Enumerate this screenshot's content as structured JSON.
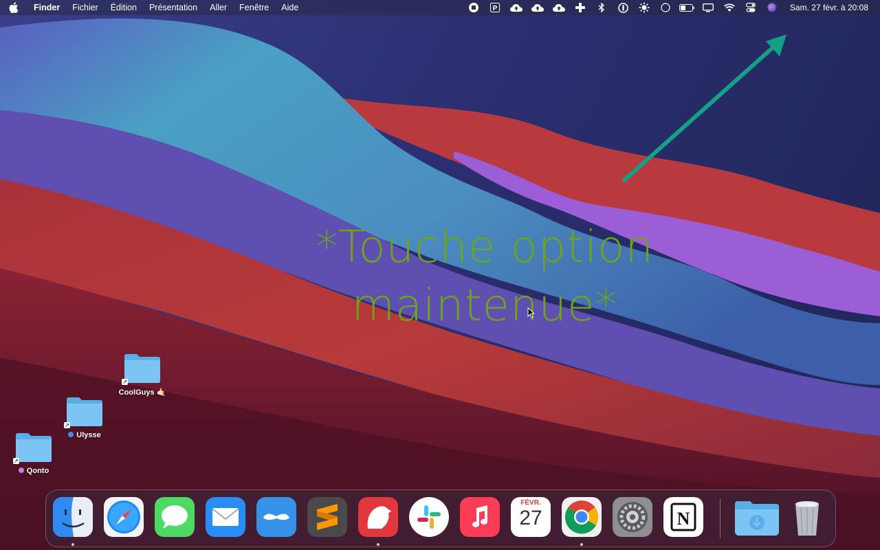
{
  "menubar": {
    "app_name": "Finder",
    "menus": [
      "Fichier",
      "Édition",
      "Présentation",
      "Aller",
      "Fenêtre",
      "Aide"
    ],
    "status_icons": [
      "stop-icon",
      "parking-icon",
      "cloud-upload-icon",
      "cloud-upload-icon",
      "cloud-upload-icon",
      "cross-icon",
      "bluetooth-icon",
      "one-password-icon",
      "sun-icon",
      "circle-icon",
      "battery-icon",
      "display-icon",
      "wifi-icon",
      "control-center-icon",
      "siri-icon"
    ],
    "clock": "Sam. 27 févr. à  20:08"
  },
  "overlay": {
    "line1": "*Touche option",
    "line2": "maintenue*",
    "color": "#6ea41a",
    "arrow_color": "#14a085"
  },
  "desktop_icons": [
    {
      "label": "CoolGuys 🤙🏻",
      "tag_color": null
    },
    {
      "label": "Ulysse",
      "tag_color": "#3b8ef0"
    },
    {
      "label": "Qonto",
      "tag_color": "#c27ee0"
    }
  ],
  "dock": {
    "apps": [
      "Finder",
      "Safari",
      "Messages",
      "Mail",
      "Mastodon",
      "Sublime Text",
      "Bear",
      "Slack",
      "Musique",
      "Calendrier",
      "Google Chrome",
      "Préférences Système",
      "Notion"
    ],
    "calendar_month": "FÉVR.",
    "calendar_day": "27",
    "others": [
      "Téléchargements",
      "Corbeille"
    ]
  }
}
